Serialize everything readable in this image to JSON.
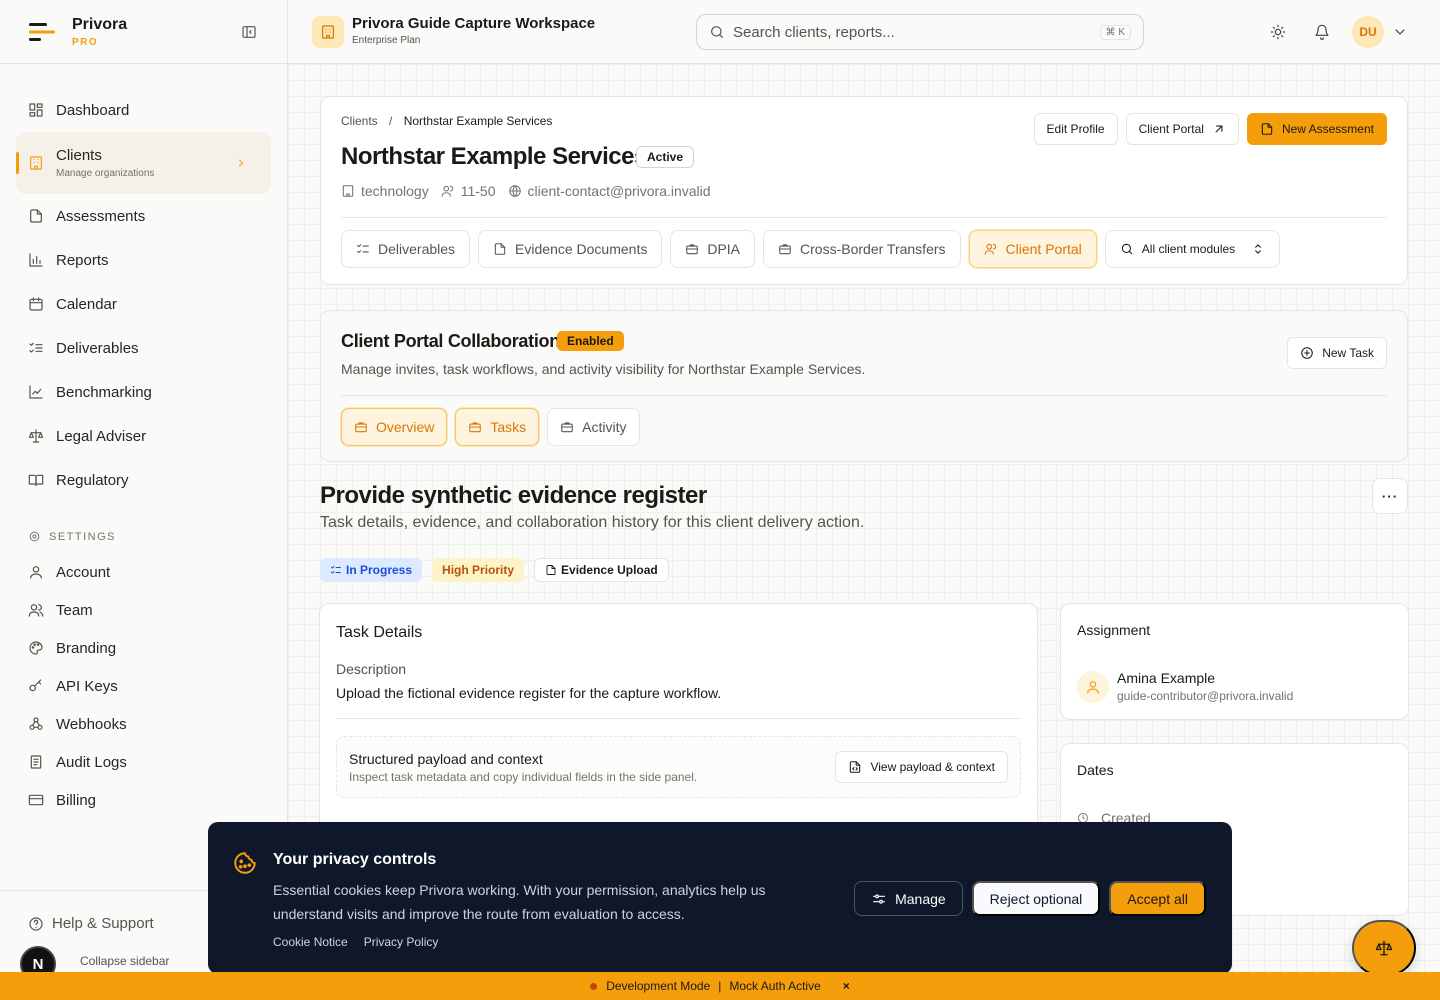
{
  "brand": {
    "name": "Privora",
    "tier": "PRO"
  },
  "sidebar": {
    "items": [
      {
        "label": "Dashboard",
        "icon": "dashboard-icon"
      },
      {
        "label": "Clients",
        "sub": "Manage organizations",
        "icon": "building-icon"
      },
      {
        "label": "Assessments",
        "icon": "file-icon"
      },
      {
        "label": "Reports",
        "icon": "bar-chart-icon"
      },
      {
        "label": "Calendar",
        "icon": "calendar-icon"
      },
      {
        "label": "Deliverables",
        "icon": "list-check-icon"
      },
      {
        "label": "Benchmarking",
        "icon": "line-chart-icon"
      },
      {
        "label": "Legal Adviser",
        "icon": "scale-icon"
      },
      {
        "label": "Regulatory",
        "icon": "book-icon"
      }
    ],
    "settings_label": "SETTINGS",
    "settings": [
      {
        "label": "Account",
        "icon": "user-icon"
      },
      {
        "label": "Team",
        "icon": "users-icon"
      },
      {
        "label": "Branding",
        "icon": "palette-icon"
      },
      {
        "label": "API Keys",
        "icon": "key-icon"
      },
      {
        "label": "Webhooks",
        "icon": "webhook-icon"
      },
      {
        "label": "Audit Logs",
        "icon": "audit-icon"
      },
      {
        "label": "Billing",
        "icon": "card-icon"
      }
    ],
    "help": "Help & Support",
    "collapse": "Collapse sidebar",
    "avatar_letter": "N"
  },
  "header": {
    "title": "Privora Guide Capture Workspace",
    "plan": "Enterprise Plan",
    "search_placeholder": "Search clients, reports...",
    "shortcut": "⌘ K",
    "user_initials": "DU"
  },
  "client": {
    "breadcrumb_root": "Clients",
    "breadcrumb_sep": "/",
    "breadcrumb_current": "Northstar Example Services",
    "name": "Northstar Example Services",
    "status": "Active",
    "industry": "technology",
    "size": "11-50",
    "contact": "client-contact@privora.invalid",
    "actions": {
      "edit": "Edit Profile",
      "portal": "Client Portal",
      "new": "New Assessment"
    },
    "tabs": [
      "Deliverables",
      "Evidence Documents",
      "DPIA",
      "Cross-Border Transfers",
      "Client Portal"
    ],
    "module_select": "All client modules"
  },
  "collab": {
    "title": "Client Portal Collaboration",
    "badge": "Enabled",
    "description": "Manage invites, task workflows, and activity visibility for Northstar Example Services.",
    "new_task": "New Task",
    "tabs": [
      "Overview",
      "Tasks",
      "Activity"
    ]
  },
  "task": {
    "title": "Provide synthetic evidence register",
    "subtitle": "Task details, evidence, and collaboration history for this client delivery action.",
    "more": "···",
    "badges": {
      "status": "In Progress",
      "priority": "High Priority",
      "type": "Evidence Upload"
    },
    "details": {
      "heading": "Task Details",
      "desc_label": "Description",
      "desc": "Upload the fictional evidence register for the capture workflow.",
      "payload_title": "Structured payload and context",
      "payload_sub": "Inspect task metadata and copy individual fields in the side panel.",
      "payload_btn": "View payload & context"
    },
    "assignment": {
      "heading": "Assignment",
      "name": "Amina Example",
      "email": "guide-contributor@privora.invalid"
    },
    "dates": {
      "heading": "Dates",
      "created": "Created"
    }
  },
  "cookie": {
    "title": "Your privacy controls",
    "text": "Essential cookies keep Privora working. With your permission, analytics help us understand visits and improve the route from evaluation to access.",
    "link1": "Cookie Notice",
    "link2": "Privacy Policy",
    "manage": "Manage",
    "reject": "Reject optional",
    "accept": "Accept all"
  },
  "devbar": {
    "mode": "Development Mode",
    "sep": "|",
    "auth": "Mock Auth Active",
    "close": "×"
  },
  "colors": {
    "accent": "#f59e0b",
    "banner": "#0f172a",
    "progress": "#1d4ed8"
  }
}
